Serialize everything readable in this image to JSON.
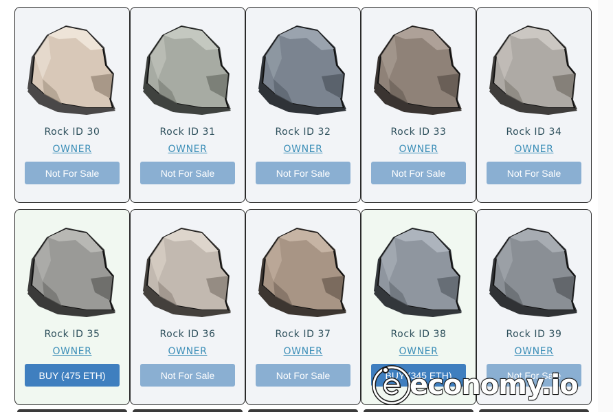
{
  "cards": [
    {
      "rock_id": "Rock ID 30",
      "owner": "OWNER",
      "button": "Not For Sale",
      "for_sale": false,
      "colors": {
        "base": "#d8c8b8",
        "light": "#eee4d8",
        "shadow": "#a89888",
        "dark": "#4a4848"
      }
    },
    {
      "rock_id": "Rock ID 31",
      "owner": "OWNER",
      "button": "Not For Sale",
      "for_sale": false,
      "colors": {
        "base": "#a7aba3",
        "light": "#c4c8c0",
        "shadow": "#7c8078",
        "dark": "#3f423f"
      }
    },
    {
      "rock_id": "Rock ID 32",
      "owner": "OWNER",
      "button": "Not For Sale",
      "for_sale": false,
      "colors": {
        "base": "#7b8490",
        "light": "#9aa3ae",
        "shadow": "#5a626c",
        "dark": "#2f3338"
      }
    },
    {
      "rock_id": "Rock ID 33",
      "owner": "OWNER",
      "button": "Not For Sale",
      "for_sale": false,
      "colors": {
        "base": "#8f8278",
        "light": "#aea198",
        "shadow": "#6a5f57",
        "dark": "#3a3431"
      }
    },
    {
      "rock_id": "Rock ID 34",
      "owner": "OWNER",
      "button": "Not For Sale",
      "for_sale": false,
      "colors": {
        "base": "#aeaaa5",
        "light": "#cbc7c2",
        "shadow": "#858079",
        "dark": "#3f3d3b"
      }
    },
    {
      "rock_id": "Rock ID 35",
      "owner": "OWNER",
      "button": "BUY (475 ETH)",
      "for_sale": true,
      "colors": {
        "base": "#9a9a97",
        "light": "#b8b8b4",
        "shadow": "#6f6f6c",
        "dark": "#3a3a39"
      }
    },
    {
      "rock_id": "Rock ID 36",
      "owner": "OWNER",
      "button": "Not For Sale",
      "for_sale": false,
      "colors": {
        "base": "#c2b9b0",
        "light": "#ddd5cc",
        "shadow": "#958c83",
        "dark": "#44403c"
      }
    },
    {
      "rock_id": "Rock ID 37",
      "owner": "OWNER",
      "button": "Not For Sale",
      "for_sale": false,
      "colors": {
        "base": "#a89585",
        "light": "#c6b4a4",
        "shadow": "#7b6b5e",
        "dark": "#3d3631"
      }
    },
    {
      "rock_id": "Rock ID 38",
      "owner": "OWNER",
      "button": "BUY (345 ETH)",
      "for_sale": true,
      "colors": {
        "base": "#8f969f",
        "light": "#adb4bd",
        "shadow": "#676e76",
        "dark": "#33373b"
      }
    },
    {
      "rock_id": "Rock ID 39",
      "owner": "OWNER",
      "button": "Not For Sale",
      "for_sale": false,
      "colors": {
        "base": "#8a8f95",
        "light": "#a7acb2",
        "shadow": "#63676c",
        "dark": "#303235"
      }
    }
  ],
  "watermark": {
    "text": "economy.io"
  }
}
